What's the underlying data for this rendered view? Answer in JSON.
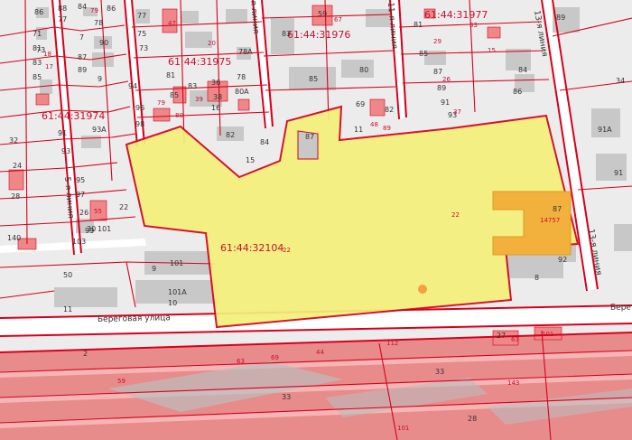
{
  "cadastral_labels": {
    "q31975": "61:44:31975",
    "q31976": "61:44:31976",
    "q31977": "61:44:31977",
    "q31974": "61:44:31974",
    "q32104": "61:44:32104",
    "q32104_suffix": "22"
  },
  "streets": {
    "beregovaya": "Береговая улица",
    "beregovaya_right": "Бере",
    "line5": "5-я линия",
    "line9": "я линия",
    "line11": "11-я линия",
    "line13_top": "13-я линия",
    "line13_mid": "13-я линия"
  },
  "numbers": {
    "n86": "86",
    "n88": "88",
    "n84": "84",
    "n86b": "86",
    "n79": "79",
    "n77": "77",
    "n71": "71",
    "n73": "73",
    "n78": "78",
    "n90": "90",
    "n81": "81",
    "n83": "83",
    "n85": "85",
    "n7": "7",
    "n18": "18",
    "n17": "17",
    "n87": "87",
    "n89": "89",
    "n9": "9",
    "n94": "94",
    "n96": "96",
    "n98": "98",
    "n91": "91",
    "n32": "32",
    "n93a": "93А",
    "n93": "93",
    "n95": "95",
    "n97": "97",
    "n99": "99",
    "n103": "103",
    "n101": "101",
    "n140": "140",
    "n50": "50",
    "n11": "11",
    "n22": "22",
    "n26": "26",
    "n30": "30",
    "n24": "24",
    "n28": "28",
    "n55": "55",
    "c77": "77",
    "c75": "75",
    "c73": "73",
    "c85": "85",
    "c83": "83",
    "c81": "81",
    "c79": "79",
    "c80": "80",
    "c36": "36",
    "c38": "38",
    "c80a": "80А",
    "c78": "78",
    "c78a": "78А",
    "c16": "16",
    "c82": "82",
    "c84": "84",
    "c15": "15",
    "c87": "87",
    "c47": "47",
    "c20": "20",
    "c39": "39",
    "d83": "83",
    "d85": "85",
    "d59": "59",
    "d67": "67",
    "d80": "80",
    "d69": "69",
    "d82": "82",
    "d11": "11",
    "d48": "48",
    "d89": "89",
    "e81": "81",
    "e85": "85",
    "e87": "87",
    "e89": "89",
    "e91": "91",
    "e93": "93",
    "e86": "86",
    "e84": "84",
    "e37": "37",
    "e26": "26",
    "e15": "15",
    "e29": "29",
    "e33": "33",
    "e89b": "89",
    "f91a": "91А",
    "f91": "91",
    "f34": "34",
    "g87": "87",
    "g92": "92",
    "g8": "8",
    "g14757": "14757",
    "g22": "22",
    "h9": "9",
    "h101": "101",
    "h101a": "101А",
    "h10": "10",
    "i2": "2",
    "i63": "63",
    "i69": "69",
    "i44": "44",
    "i112": "112",
    "i33": "33",
    "i59": "59",
    "i33b": "33",
    "i143": "143",
    "i27": "27",
    "i63b": "63",
    "i101": "101",
    "i28": "28",
    "i101b": "101"
  },
  "colors": {
    "parcel_fill": "#f4f07a",
    "parcel_stroke": "#d6001c",
    "highlight_fill": "#f2b13d",
    "rail_fill": "#e87a7a",
    "building": "#c8c8c8",
    "background": "#ececec"
  }
}
